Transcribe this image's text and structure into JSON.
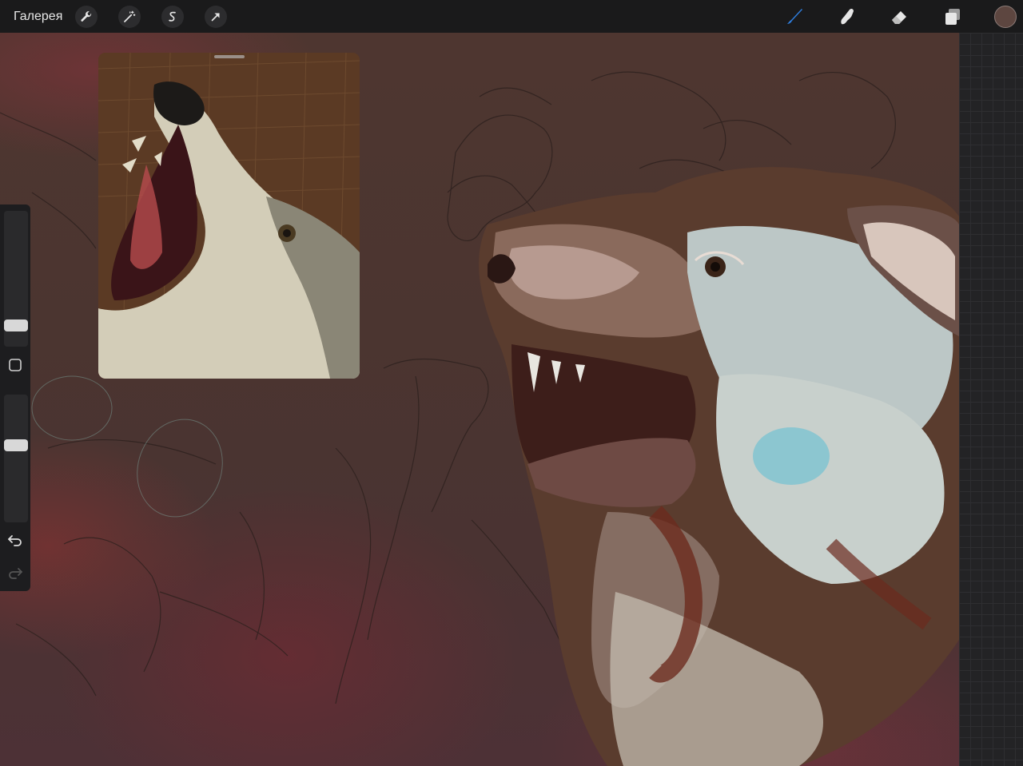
{
  "toolbar": {
    "gallery_label": "Галерея",
    "left_tools": [
      {
        "name": "wrench-icon"
      },
      {
        "name": "magic-wand-icon"
      },
      {
        "name": "selection-icon"
      },
      {
        "name": "transform-arrow-icon"
      }
    ],
    "right_tools": [
      {
        "name": "brush-icon",
        "active": true,
        "color": "#2f7fe0"
      },
      {
        "name": "smudge-icon",
        "active": false
      },
      {
        "name": "eraser-icon",
        "active": false
      },
      {
        "name": "layers-icon",
        "active": false
      }
    ],
    "current_color": "#5d4640"
  },
  "sidebar": {
    "brush_size_slider": {
      "label": "brush-size"
    },
    "modifier_button": {
      "label": "modifier"
    },
    "opacity_slider": {
      "label": "opacity"
    },
    "undo": {
      "icon": "undo-icon"
    },
    "redo": {
      "icon": "redo-icon",
      "enabled": false
    }
  },
  "reference_window": {
    "description": "wolf-photo"
  },
  "canvas": {
    "background_color": "#4b3530",
    "artwork": "wolf-head-painting"
  }
}
